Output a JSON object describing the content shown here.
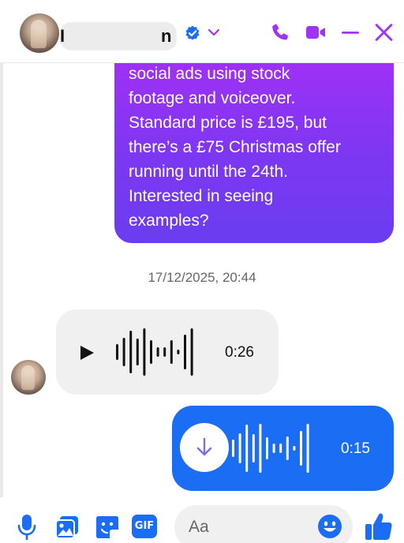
{
  "header": {
    "name_visible_start": "I",
    "name_visible_end": "n",
    "icons": [
      "verified-badge-icon",
      "chevron-down-icon",
      "phone-icon",
      "video-camera-icon",
      "minimize-icon",
      "close-icon"
    ],
    "accent_color": "#a033f5"
  },
  "messages": {
    "outgoing_text": {
      "lines": [
        "social ads using stock",
        "footage and voiceover.",
        "Standard price is £195, but",
        "there’s a £75 Christmas offer",
        "running until the 24th.",
        "Interested in seeing",
        "examples?"
      ],
      "gradient_top": "#a330f5",
      "gradient_bottom": "#6a3df0"
    },
    "timestamp": "17/12/2025, 20:44",
    "incoming_voice": {
      "duration": "0:26",
      "icons": [
        "play-icon",
        "waveform-icon"
      ],
      "bubble_color": "#f0f0f0"
    },
    "outgoing_voice": {
      "duration": "0:15",
      "icons": [
        "download-icon",
        "waveform-icon"
      ],
      "bubble_color": "#1b6ef3"
    }
  },
  "composer": {
    "placeholder": "Aa",
    "icons": [
      "microphone-icon",
      "photo-icon",
      "sticker-icon",
      "gif-icon",
      "emoji-icon",
      "thumbs-up-icon"
    ],
    "gif_label": "GIF",
    "icon_color": "#1b6ef3"
  }
}
